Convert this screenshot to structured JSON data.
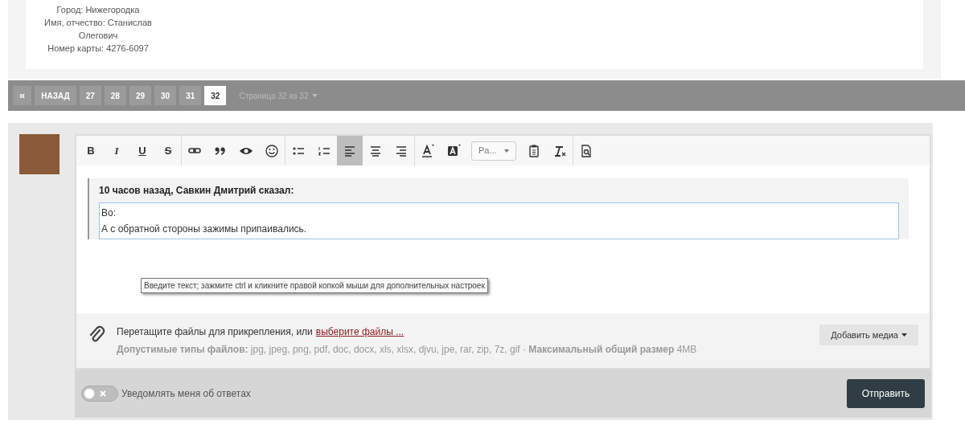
{
  "profile": [
    {
      "label": "Город:",
      "value": "Нижегородка"
    },
    {
      "label": "Имя, отчество:",
      "value": "Станислав Олегович"
    },
    {
      "label": "Номер карты:",
      "value": "4276-6097"
    }
  ],
  "pagination": {
    "first": "«",
    "prev": "НАЗАД",
    "pages": [
      {
        "label": "27",
        "selected": false
      },
      {
        "label": "28",
        "selected": false
      },
      {
        "label": "29",
        "selected": false
      },
      {
        "label": "30",
        "selected": false
      },
      {
        "label": "31",
        "selected": false
      },
      {
        "label": "32",
        "selected": true
      }
    ],
    "info": "Страница 32 из 32"
  },
  "toolbar": [
    [
      {
        "kind": "text",
        "label": "B"
      },
      {
        "kind": "text",
        "label": "I"
      },
      {
        "kind": "text",
        "label": "U"
      },
      {
        "kind": "text",
        "label": "S"
      }
    ],
    [
      {
        "kind": "icon"
      },
      {
        "kind": "icon"
      },
      {
        "kind": "icon"
      },
      {
        "kind": "icon"
      }
    ],
    [
      {
        "kind": "icon"
      },
      {
        "kind": "icon"
      },
      {
        "kind": "icon",
        "selected": true
      },
      {
        "kind": "icon",
        "selected": false
      },
      {
        "kind": "icon",
        "selected": false
      }
    ],
    [
      {
        "kind": "icon"
      },
      {
        "kind": "icon"
      },
      {
        "kind": "dropdown",
        "label": "Pa..."
      },
      {
        "kind": "icon"
      },
      {
        "kind": "icon"
      }
    ],
    [
      {
        "kind": "icon"
      }
    ]
  ],
  "quote": {
    "header": "10 часов назад, Савкин Дмитрий сказал:",
    "lines": [
      "Во:",
      "А с обратной стороны зажимы припаивались."
    ]
  },
  "tooltip": "Введите текст; зажмите ctrl и кликните правой копкой мыши для дополнительных настроек",
  "attach": {
    "text": "Перетащите файлы для прикрепления, или",
    "link": "выберите файлы ...",
    "types": "**Допустимые типы файлов:** jpg, jpeg, png, pdf, doc, docx, xls, xlsx, djvu, jpe, rar, zip, 7z, gif · **Максимальный общий размер** 4MB",
    "media_button": "Добавить медиа"
  },
  "notify": {
    "label": "Уведомлять меня об ответах",
    "on": false
  },
  "submit": "Отправить"
}
